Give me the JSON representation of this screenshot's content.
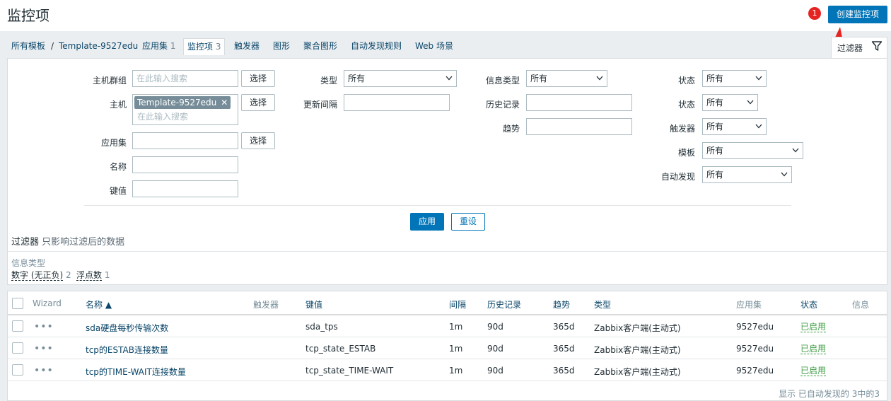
{
  "header": {
    "title": "监控项",
    "create_button": "创建监控项",
    "badge": "1"
  },
  "tabs": {
    "crumb_all_templates": "所有模板",
    "crumb_sep": "/",
    "crumb_template": "Template-9527edu",
    "applications": "应用集",
    "applications_count": "1",
    "items": "监控项",
    "items_count": "3",
    "triggers": "触发器",
    "graphs": "图形",
    "screens": "聚合图形",
    "discovery": "自动发现规则",
    "web": "Web 场景"
  },
  "filter": {
    "tab_label": "过滤器",
    "host_group_label": "主机群组",
    "host_group_placeholder": "在此输入搜索",
    "select": "选择",
    "host_label": "主机",
    "host_chip": "Template-9527edu",
    "host_placeholder": "在此输入搜索",
    "application_label": "应用集",
    "name_label": "名称",
    "key_label": "键值",
    "type_label": "类型",
    "type_value": "所有",
    "update_interval_label": "更新间隔",
    "info_type_label": "信息类型",
    "info_type_value": "所有",
    "history_label": "历史记录",
    "trends_label": "趋势",
    "state_label": "状态",
    "state_value": "所有",
    "status_label": "状态",
    "status_value": "所有",
    "triggers_label": "触发器",
    "triggers_value": "所有",
    "template_label": "模板",
    "template_value": "所有",
    "discovery_label": "自动发现",
    "discovery_value": "所有",
    "apply": "应用",
    "reset": "重设",
    "note_strong": "过滤器",
    "note_text": "只影响过滤后的数据",
    "subfilter_title": "信息类型",
    "subfilter_numeric": "数字 (无正负)",
    "subfilter_numeric_count": "2",
    "subfilter_float": "浮点数",
    "subfilter_float_count": "1"
  },
  "table": {
    "headers": {
      "wizard": "Wizard",
      "name": "名称 ▲",
      "triggers": "触发器",
      "key": "键值",
      "interval": "间隔",
      "history": "历史记录",
      "trends": "趋势",
      "type": "类型",
      "applications": "应用集",
      "status": "状态",
      "info": "信息"
    },
    "rows": [
      {
        "name": "sda硬盘每秒传输次数",
        "key": "sda_tps",
        "interval": "1m",
        "history": "90d",
        "trends": "365d",
        "type": "Zabbix客户端(主动式)",
        "application": "9527edu",
        "status": "已启用"
      },
      {
        "name": "tcp的ESTAB连接数量",
        "key": "tcp_state_ESTAB",
        "interval": "1m",
        "history": "90d",
        "trends": "365d",
        "type": "Zabbix客户端(主动式)",
        "application": "9527edu",
        "status": "已启用"
      },
      {
        "name": "tcp的TIME-WAIT连接数量",
        "key": "tcp_state_TIME-WAIT",
        "interval": "1m",
        "history": "90d",
        "trends": "365d",
        "type": "Zabbix客户端(主动式)",
        "application": "9527edu",
        "status": "已启用"
      }
    ],
    "footer": "显示 已自动发现的 3中的3",
    "wizard_dots": "•••"
  },
  "colors": {
    "primary": "#0275b8",
    "link": "#0a466a",
    "enabled": "#429e47",
    "annotation": "#e52421"
  }
}
